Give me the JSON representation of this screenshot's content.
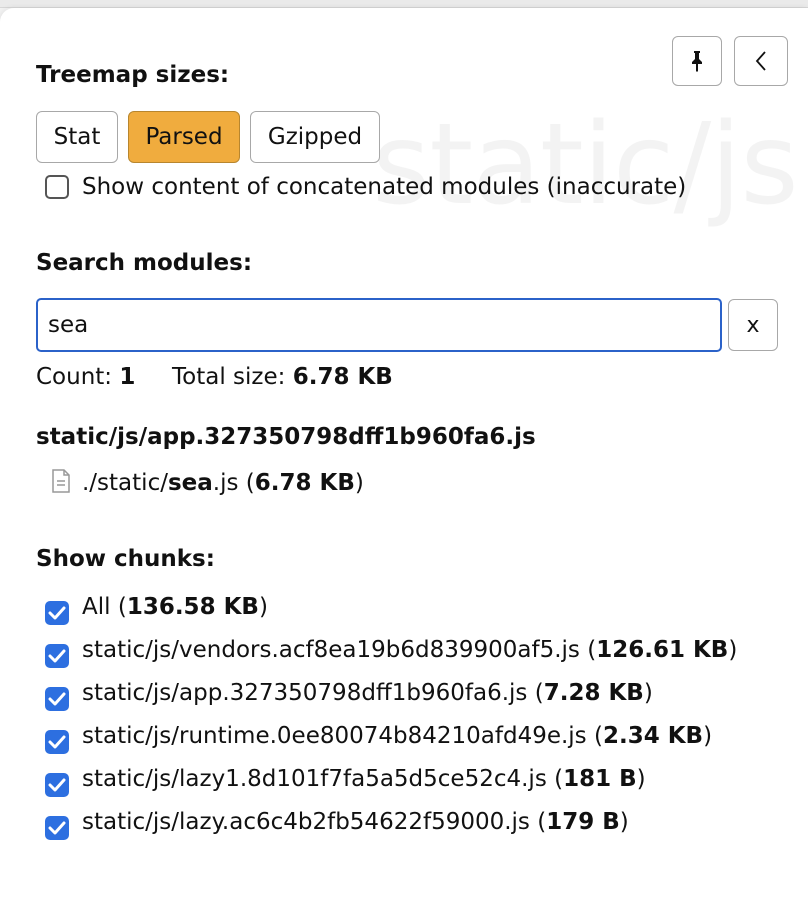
{
  "watermark": "static/js",
  "treemap": {
    "title": "Treemap sizes:",
    "buttons": [
      {
        "label": "Stat",
        "active": false
      },
      {
        "label": "Parsed",
        "active": true
      },
      {
        "label": "Gzipped",
        "active": false
      }
    ],
    "concat_label": "Show content of concatenated modules (inaccurate)",
    "concat_checked": false
  },
  "search": {
    "title": "Search modules:",
    "value": "sea",
    "clear_label": "x",
    "count_label": "Count:",
    "count": "1",
    "total_label": "Total size:",
    "total": "6.78 KB"
  },
  "results": {
    "chunk": "static/js/app.327350798dff1b960fa6.js",
    "module_prefix": "./static/",
    "module_match": "sea",
    "module_suffix": ".js (",
    "module_size": "6.78 KB",
    "module_close": ")"
  },
  "chunks": {
    "title": "Show chunks:",
    "items": [
      {
        "name": "All",
        "size": "136.58 KB",
        "checked": true
      },
      {
        "name": "static/js/vendors.acf8ea19b6d839900af5.js",
        "size": "126.61 KB",
        "checked": true
      },
      {
        "name": "static/js/app.327350798dff1b960fa6.js",
        "size": "7.28 KB",
        "checked": true
      },
      {
        "name": "static/js/runtime.0ee80074b84210afd49e.js",
        "size": "2.34 KB",
        "checked": true
      },
      {
        "name": "static/js/lazy1.8d101f7fa5a5d5ce52c4.js",
        "size": "181 B",
        "checked": true
      },
      {
        "name": "static/js/lazy.ac6c4b2fb54622f59000.js",
        "size": "179 B",
        "checked": true
      }
    ]
  },
  "icons": {
    "pin": "pin-icon",
    "collapse": "chevron-left-icon",
    "file": "file-icon",
    "check": "checkmark-icon"
  },
  "colors": {
    "active_button": "#f0ac3e",
    "focus_border": "#2b62c9",
    "checkbox": "#2d6fe0"
  }
}
